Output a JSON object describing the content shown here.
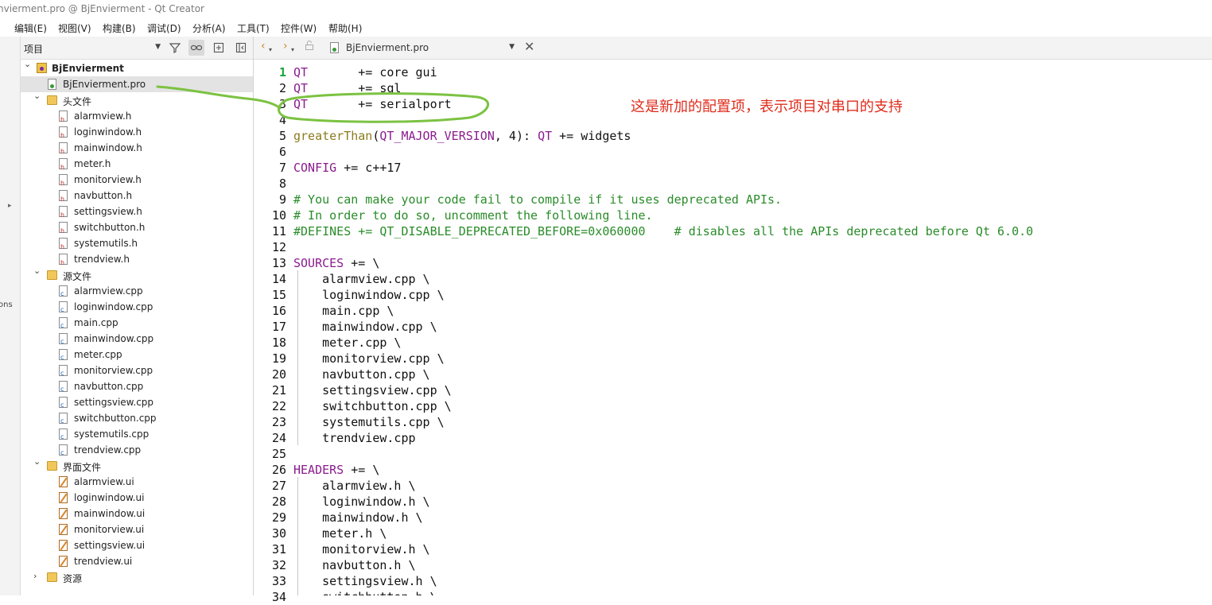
{
  "window": {
    "title": "nvierment.pro @ BjEnvierment - Qt Creator"
  },
  "menu": [
    "编辑(E)",
    "视图(V)",
    "构建(B)",
    "调试(D)",
    "分析(A)",
    "工具(T)",
    "控件(W)",
    "帮助(H)"
  ],
  "sidebar": {
    "modes_fragment": "ons"
  },
  "project_panel": {
    "selector_label": "项目",
    "root": "BjEnvierment",
    "pro_file": "BjEnvierment.pro",
    "groups": [
      {
        "name": "头文件",
        "kind": "h",
        "expanded": true,
        "files": [
          "alarmview.h",
          "loginwindow.h",
          "mainwindow.h",
          "meter.h",
          "monitorview.h",
          "navbutton.h",
          "settingsview.h",
          "switchbutton.h",
          "systemutils.h",
          "trendview.h"
        ]
      },
      {
        "name": "源文件",
        "kind": "cpp",
        "expanded": true,
        "files": [
          "alarmview.cpp",
          "loginwindow.cpp",
          "main.cpp",
          "mainwindow.cpp",
          "meter.cpp",
          "monitorview.cpp",
          "navbutton.cpp",
          "settingsview.cpp",
          "switchbutton.cpp",
          "systemutils.cpp",
          "trendview.cpp"
        ]
      },
      {
        "name": "界面文件",
        "kind": "ui",
        "expanded": true,
        "files": [
          "alarmview.ui",
          "loginwindow.ui",
          "mainwindow.ui",
          "monitorview.ui",
          "settingsview.ui",
          "trendview.ui"
        ]
      },
      {
        "name": "资源",
        "kind": "res",
        "expanded": false,
        "files": []
      }
    ]
  },
  "editor": {
    "document": "BjEnvierment.pro",
    "current_line": 1,
    "lines": [
      [
        [
          "var",
          "QT"
        ],
        [
          "",
          "       += core gui"
        ]
      ],
      [
        [
          "var",
          "QT"
        ],
        [
          "",
          "       += sql"
        ]
      ],
      [
        [
          "var",
          "QT"
        ],
        [
          "",
          "       += serialport"
        ]
      ],
      [],
      [
        [
          "fn",
          "greaterThan"
        ],
        [
          "",
          "("
        ],
        [
          "var",
          "QT_MAJOR_VERSION"
        ],
        [
          "",
          ", 4): "
        ],
        [
          "var",
          "QT"
        ],
        [
          "",
          " += widgets"
        ]
      ],
      [],
      [
        [
          "var",
          "CONFIG"
        ],
        [
          "",
          " += c++17"
        ]
      ],
      [],
      [
        [
          "cm",
          "# You can make your code fail to compile if it uses deprecated APIs."
        ]
      ],
      [
        [
          "cm",
          "# In order to do so, uncomment the following line."
        ]
      ],
      [
        [
          "cm",
          "#DEFINES += QT_DISABLE_DEPRECATED_BEFORE=0x060000    # disables all the APIs deprecated before Qt 6.0.0"
        ]
      ],
      [],
      [
        [
          "var",
          "SOURCES"
        ],
        [
          "",
          " += \\"
        ]
      ],
      [
        [
          "",
          "    alarmview.cpp \\"
        ]
      ],
      [
        [
          "",
          "    loginwindow.cpp \\"
        ]
      ],
      [
        [
          "",
          "    main.cpp \\"
        ]
      ],
      [
        [
          "",
          "    mainwindow.cpp \\"
        ]
      ],
      [
        [
          "",
          "    meter.cpp \\"
        ]
      ],
      [
        [
          "",
          "    monitorview.cpp \\"
        ]
      ],
      [
        [
          "",
          "    navbutton.cpp \\"
        ]
      ],
      [
        [
          "",
          "    settingsview.cpp \\"
        ]
      ],
      [
        [
          "",
          "    switchbutton.cpp \\"
        ]
      ],
      [
        [
          "",
          "    systemutils.cpp \\"
        ]
      ],
      [
        [
          "",
          "    trendview.cpp"
        ]
      ],
      [],
      [
        [
          "var",
          "HEADERS"
        ],
        [
          "",
          " += \\"
        ]
      ],
      [
        [
          "",
          "    alarmview.h \\"
        ]
      ],
      [
        [
          "",
          "    loginwindow.h \\"
        ]
      ],
      [
        [
          "",
          "    mainwindow.h \\"
        ]
      ],
      [
        [
          "",
          "    meter.h \\"
        ]
      ],
      [
        [
          "",
          "    monitorview.h \\"
        ]
      ],
      [
        [
          "",
          "    navbutton.h \\"
        ]
      ],
      [
        [
          "",
          "    settingsview.h \\"
        ]
      ],
      [
        [
          "",
          "    switchbutton.h \\"
        ]
      ]
    ]
  },
  "annotation": {
    "text": "这是新加的配置项，表示项目对串口的支持",
    "color": "#e02c1c"
  },
  "colors": {
    "keyword": "#8a1c8e",
    "function": "#8c7b1d",
    "comment": "#2a8c2a",
    "highlight_circle": "#7cc242",
    "line_number_current": "#19a33a"
  },
  "icons": [
    "back-arrow-icon",
    "forward-arrow-icon",
    "lock-icon",
    "filter-icon",
    "link-icon",
    "split-icon",
    "close-icon"
  ]
}
